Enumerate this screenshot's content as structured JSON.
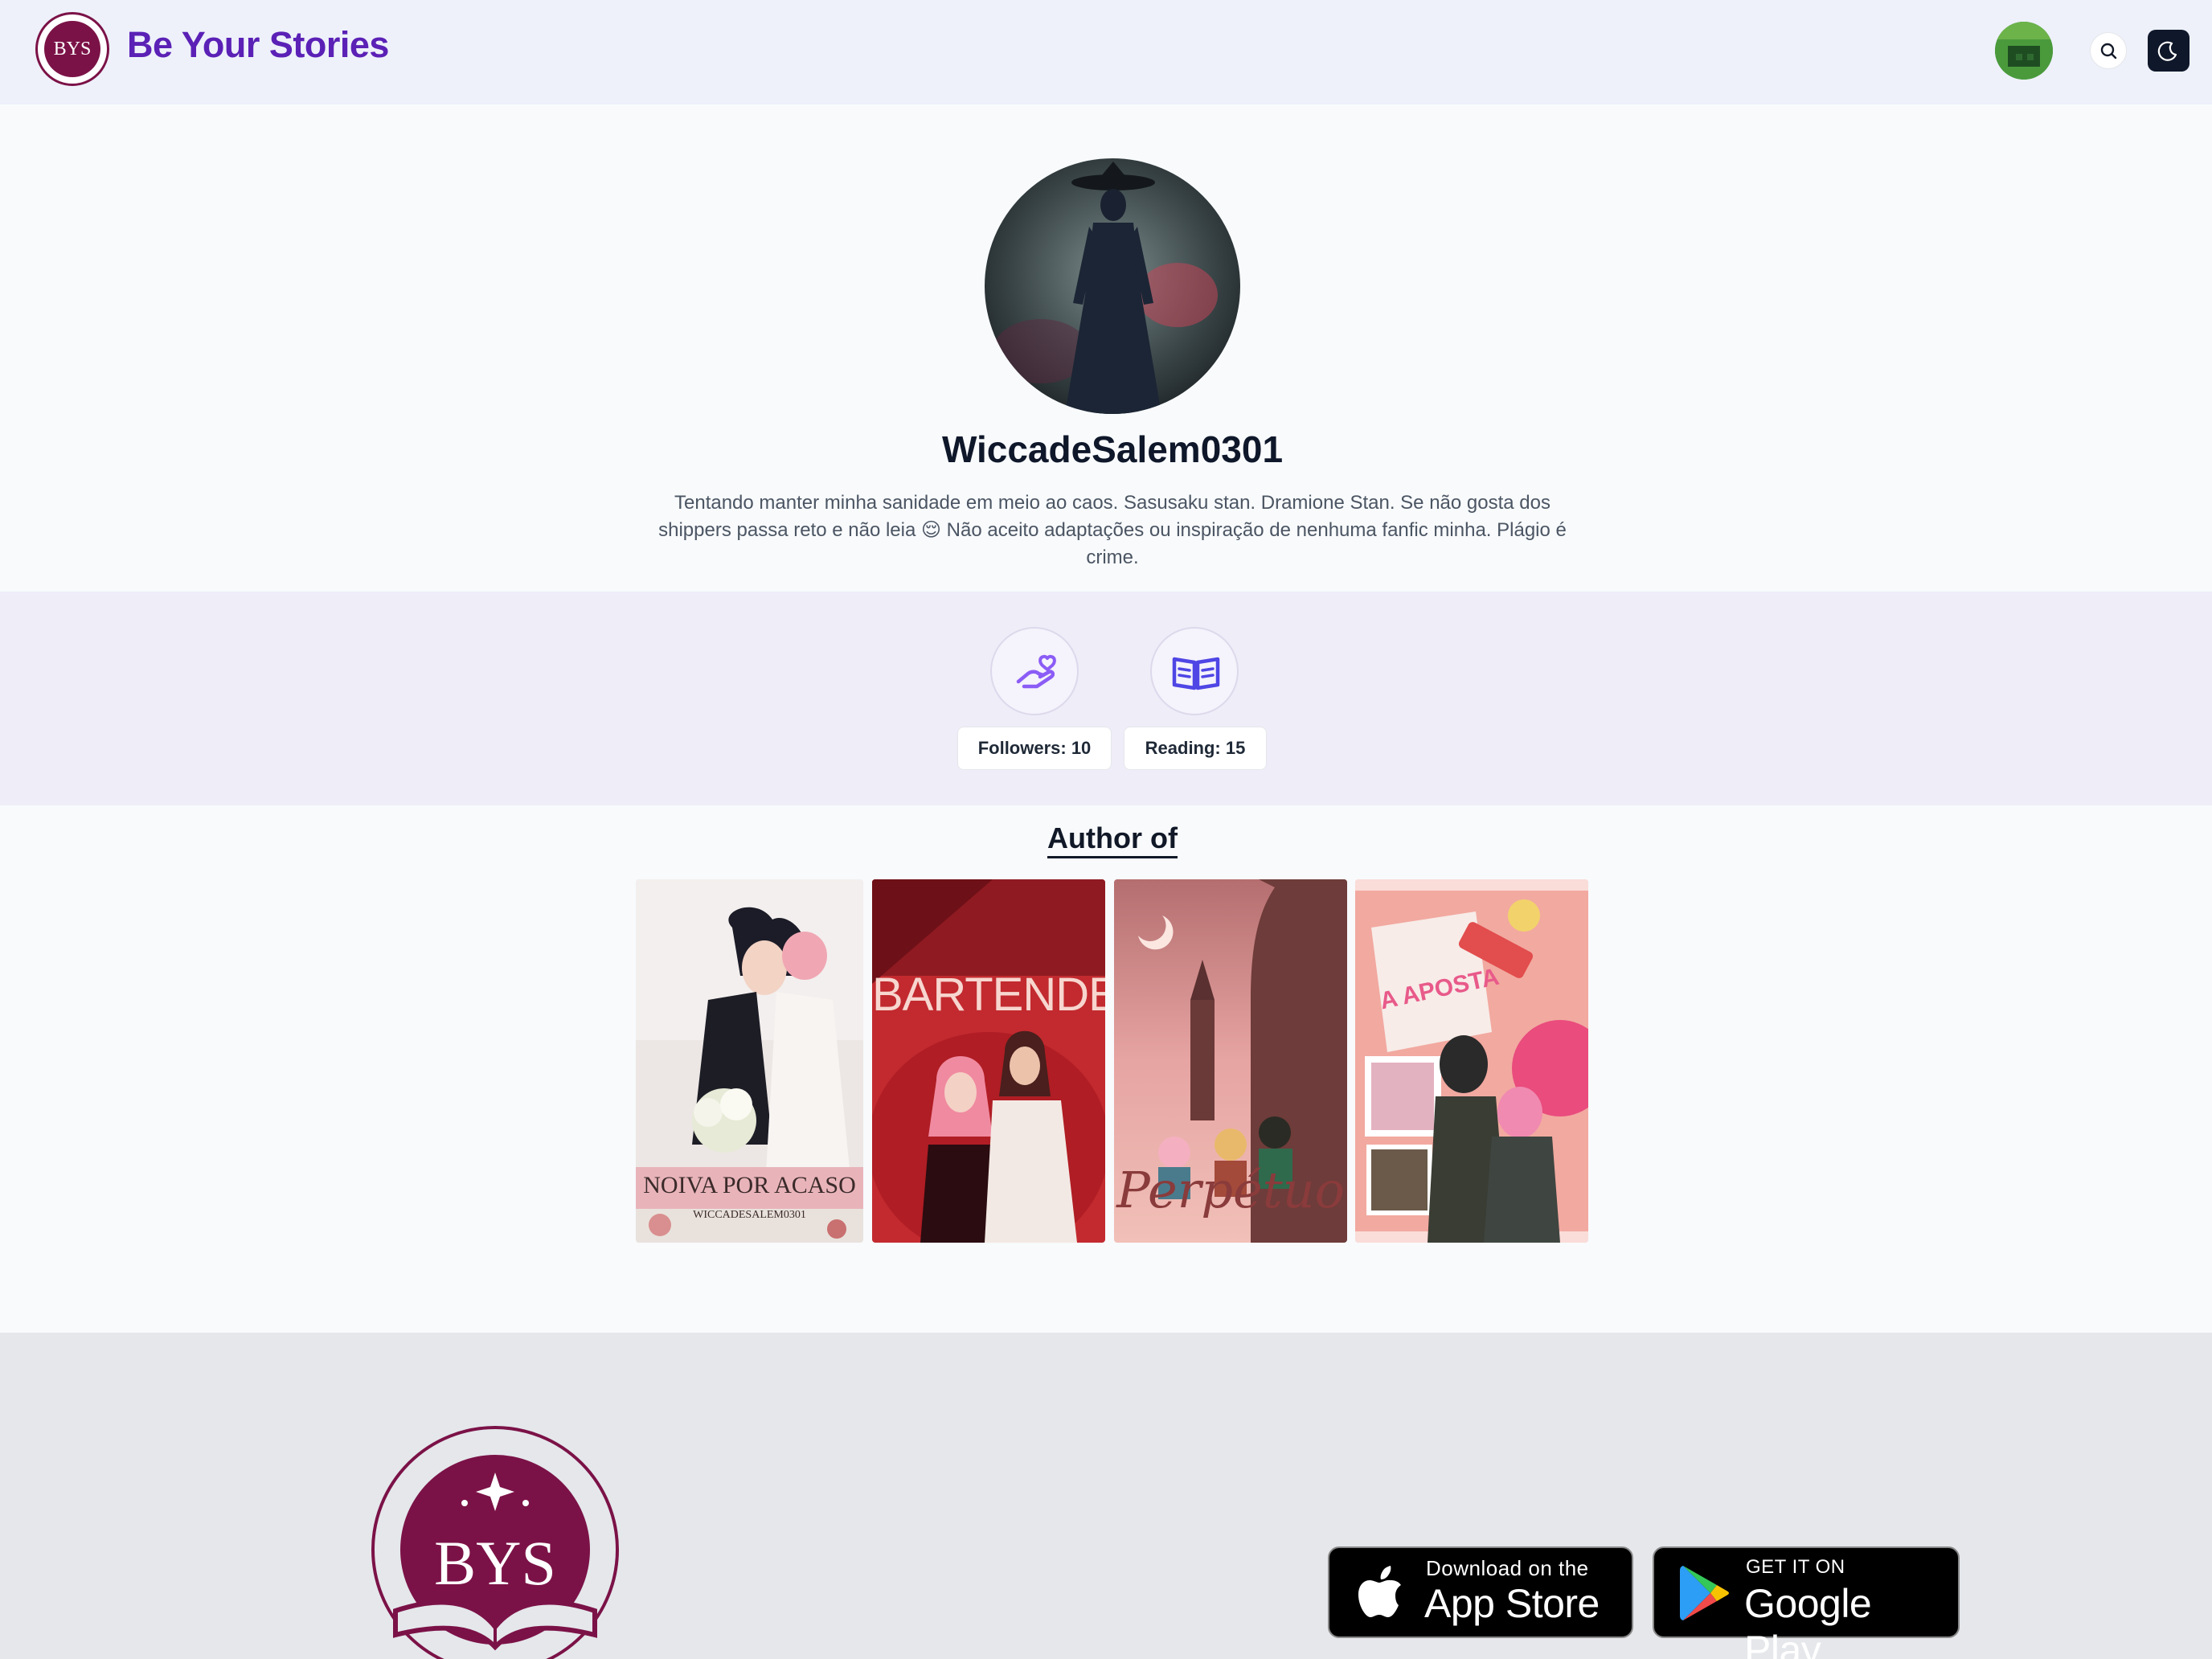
{
  "header": {
    "logo_text": "BYS",
    "brand_name": "Be Your Stories"
  },
  "profile": {
    "username": "WiccadeSalem0301",
    "bio": "Tentando manter minha sanidade em meio ao caos. Sasusaku stan. Dramione Stan. Se não gosta dos shippers passa reto e não leia 😌 Não aceito adaptações ou inspiração de nenhuma fanfic minha. Plágio é crime."
  },
  "stats": {
    "followers_label": "Followers: 10",
    "reading_label": "Reading: 15"
  },
  "author_section": {
    "title": "Author of",
    "books": [
      {
        "title": "NOIVA POR ACASO",
        "subtitle": "WICCADESALEM0301"
      },
      {
        "title": "BARTENDER"
      },
      {
        "title": "Perpétuo"
      },
      {
        "title": "A APOSTA"
      }
    ]
  },
  "footer": {
    "logo_text": "BYS",
    "app_store": {
      "small": "Download on the",
      "big": "App Store"
    },
    "google_play": {
      "small": "GET IT ON",
      "big": "Google Play"
    }
  },
  "colors": {
    "brand": "#5b21b6",
    "logo_maroon": "#7b1247",
    "stats_band": "#efedf8",
    "footer_bg": "#e5e7eb"
  },
  "icons": [
    "search-icon",
    "moon-icon",
    "hand-heart-icon",
    "open-book-icon",
    "apple-icon",
    "google-play-icon"
  ]
}
